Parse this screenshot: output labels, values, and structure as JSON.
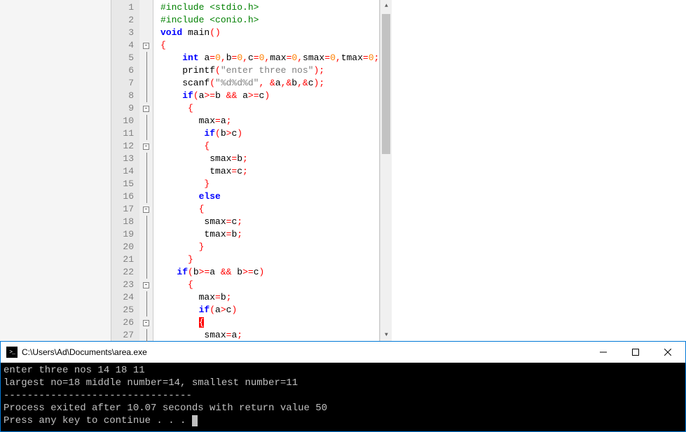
{
  "editor": {
    "lines": [
      {
        "n": 1,
        "fold": "",
        "segs": [
          [
            "kw-green",
            "#include "
          ],
          [
            "kw-green",
            "<stdio.h>"
          ]
        ]
      },
      {
        "n": 2,
        "fold": "",
        "segs": [
          [
            "kw-green",
            "#include "
          ],
          [
            "kw-green",
            "<conio.h>"
          ]
        ]
      },
      {
        "n": 3,
        "fold": "",
        "segs": [
          [
            "kw-blue",
            "void "
          ],
          [
            "plain",
            "main"
          ],
          [
            "sym",
            "()"
          ]
        ]
      },
      {
        "n": 4,
        "fold": "box",
        "segs": [
          [
            "sym",
            "{"
          ]
        ]
      },
      {
        "n": 5,
        "fold": "line",
        "segs": [
          [
            "plain",
            "    "
          ],
          [
            "kw-blue",
            "int "
          ],
          [
            "plain",
            "a"
          ],
          [
            "sym",
            "="
          ],
          [
            "num",
            "0"
          ],
          [
            "sym",
            ","
          ],
          [
            "plain",
            "b"
          ],
          [
            "sym",
            "="
          ],
          [
            "num",
            "0"
          ],
          [
            "sym",
            ","
          ],
          [
            "plain",
            "c"
          ],
          [
            "sym",
            "="
          ],
          [
            "num",
            "0"
          ],
          [
            "sym",
            ","
          ],
          [
            "plain",
            "max"
          ],
          [
            "sym",
            "="
          ],
          [
            "num",
            "0"
          ],
          [
            "sym",
            ","
          ],
          [
            "plain",
            "smax"
          ],
          [
            "sym",
            "="
          ],
          [
            "num",
            "0"
          ],
          [
            "sym",
            ","
          ],
          [
            "plain",
            "tmax"
          ],
          [
            "sym",
            "="
          ],
          [
            "num",
            "0"
          ],
          [
            "sym",
            ";"
          ]
        ]
      },
      {
        "n": 6,
        "fold": "line",
        "segs": [
          [
            "plain",
            "    printf"
          ],
          [
            "sym",
            "("
          ],
          [
            "str",
            "\"enter three nos\""
          ],
          [
            "sym",
            ");"
          ]
        ]
      },
      {
        "n": 7,
        "fold": "line",
        "segs": [
          [
            "plain",
            "    scanf"
          ],
          [
            "sym",
            "("
          ],
          [
            "str",
            "\"%d%d%d\""
          ],
          [
            "sym",
            ", &"
          ],
          [
            "plain",
            "a"
          ],
          [
            "sym",
            ",&"
          ],
          [
            "plain",
            "b"
          ],
          [
            "sym",
            ",&"
          ],
          [
            "plain",
            "c"
          ],
          [
            "sym",
            ");"
          ]
        ]
      },
      {
        "n": 8,
        "fold": "line",
        "segs": [
          [
            "plain",
            "    "
          ],
          [
            "kw-blue",
            "if"
          ],
          [
            "sym",
            "("
          ],
          [
            "plain",
            "a"
          ],
          [
            "sym",
            ">="
          ],
          [
            "plain",
            "b "
          ],
          [
            "sym",
            "&&"
          ],
          [
            "plain",
            " a"
          ],
          [
            "sym",
            ">="
          ],
          [
            "plain",
            "c"
          ],
          [
            "sym",
            ")"
          ]
        ]
      },
      {
        "n": 9,
        "fold": "box",
        "segs": [
          [
            "plain",
            "     "
          ],
          [
            "sym",
            "{"
          ]
        ]
      },
      {
        "n": 10,
        "fold": "line",
        "segs": [
          [
            "plain",
            "       max"
          ],
          [
            "sym",
            "="
          ],
          [
            "plain",
            "a"
          ],
          [
            "sym",
            ";"
          ]
        ]
      },
      {
        "n": 11,
        "fold": "line",
        "segs": [
          [
            "plain",
            "        "
          ],
          [
            "kw-blue",
            "if"
          ],
          [
            "sym",
            "("
          ],
          [
            "plain",
            "b"
          ],
          [
            "sym",
            ">"
          ],
          [
            "plain",
            "c"
          ],
          [
            "sym",
            ")"
          ]
        ]
      },
      {
        "n": 12,
        "fold": "box",
        "segs": [
          [
            "plain",
            "        "
          ],
          [
            "sym",
            "{"
          ]
        ]
      },
      {
        "n": 13,
        "fold": "line",
        "segs": [
          [
            "plain",
            "         smax"
          ],
          [
            "sym",
            "="
          ],
          [
            "plain",
            "b"
          ],
          [
            "sym",
            ";"
          ]
        ]
      },
      {
        "n": 14,
        "fold": "line",
        "segs": [
          [
            "plain",
            "         tmax"
          ],
          [
            "sym",
            "="
          ],
          [
            "plain",
            "c"
          ],
          [
            "sym",
            ";"
          ]
        ]
      },
      {
        "n": 15,
        "fold": "line",
        "segs": [
          [
            "plain",
            "        "
          ],
          [
            "sym",
            "}"
          ]
        ]
      },
      {
        "n": 16,
        "fold": "line",
        "segs": [
          [
            "plain",
            "       "
          ],
          [
            "kw-blue",
            "else"
          ]
        ]
      },
      {
        "n": 17,
        "fold": "box",
        "segs": [
          [
            "plain",
            "       "
          ],
          [
            "sym",
            "{"
          ]
        ]
      },
      {
        "n": 18,
        "fold": "line",
        "segs": [
          [
            "plain",
            "        smax"
          ],
          [
            "sym",
            "="
          ],
          [
            "plain",
            "c"
          ],
          [
            "sym",
            ";"
          ]
        ]
      },
      {
        "n": 19,
        "fold": "line",
        "segs": [
          [
            "plain",
            "        tmax"
          ],
          [
            "sym",
            "="
          ],
          [
            "plain",
            "b"
          ],
          [
            "sym",
            ";"
          ]
        ]
      },
      {
        "n": 20,
        "fold": "line",
        "segs": [
          [
            "plain",
            "       "
          ],
          [
            "sym",
            "}"
          ]
        ]
      },
      {
        "n": 21,
        "fold": "line",
        "segs": [
          [
            "plain",
            "     "
          ],
          [
            "sym",
            "}"
          ]
        ]
      },
      {
        "n": 22,
        "fold": "line",
        "segs": [
          [
            "plain",
            "   "
          ],
          [
            "kw-blue",
            "if"
          ],
          [
            "sym",
            "("
          ],
          [
            "plain",
            "b"
          ],
          [
            "sym",
            ">="
          ],
          [
            "plain",
            "a "
          ],
          [
            "sym",
            "&&"
          ],
          [
            "plain",
            " b"
          ],
          [
            "sym",
            ">="
          ],
          [
            "plain",
            "c"
          ],
          [
            "sym",
            ")"
          ]
        ]
      },
      {
        "n": 23,
        "fold": "box",
        "segs": [
          [
            "plain",
            "     "
          ],
          [
            "sym",
            "{"
          ]
        ]
      },
      {
        "n": 24,
        "fold": "line",
        "segs": [
          [
            "plain",
            "       max"
          ],
          [
            "sym",
            "="
          ],
          [
            "plain",
            "b"
          ],
          [
            "sym",
            ";"
          ]
        ]
      },
      {
        "n": 25,
        "fold": "line",
        "segs": [
          [
            "plain",
            "       "
          ],
          [
            "kw-blue",
            "if"
          ],
          [
            "sym",
            "("
          ],
          [
            "plain",
            "a"
          ],
          [
            "sym",
            ">"
          ],
          [
            "plain",
            "c"
          ],
          [
            "sym",
            ")"
          ]
        ]
      },
      {
        "n": 26,
        "fold": "box",
        "segs": [
          [
            "plain",
            "       "
          ],
          [
            "hl",
            "{"
          ]
        ]
      },
      {
        "n": 27,
        "fold": "line",
        "segs": [
          [
            "plain",
            "        smax"
          ],
          [
            "sym",
            "="
          ],
          [
            "plain",
            "a"
          ],
          [
            "sym",
            ";"
          ]
        ]
      }
    ]
  },
  "console": {
    "title": "C:\\Users\\Ad\\Documents\\area.exe",
    "lines": [
      "enter three nos 14 18 11",
      "largest no=18 middle number=14, smallest number=11",
      "--------------------------------",
      "Process exited after 10.07 seconds with return value 50",
      "Press any key to continue . . . "
    ]
  }
}
